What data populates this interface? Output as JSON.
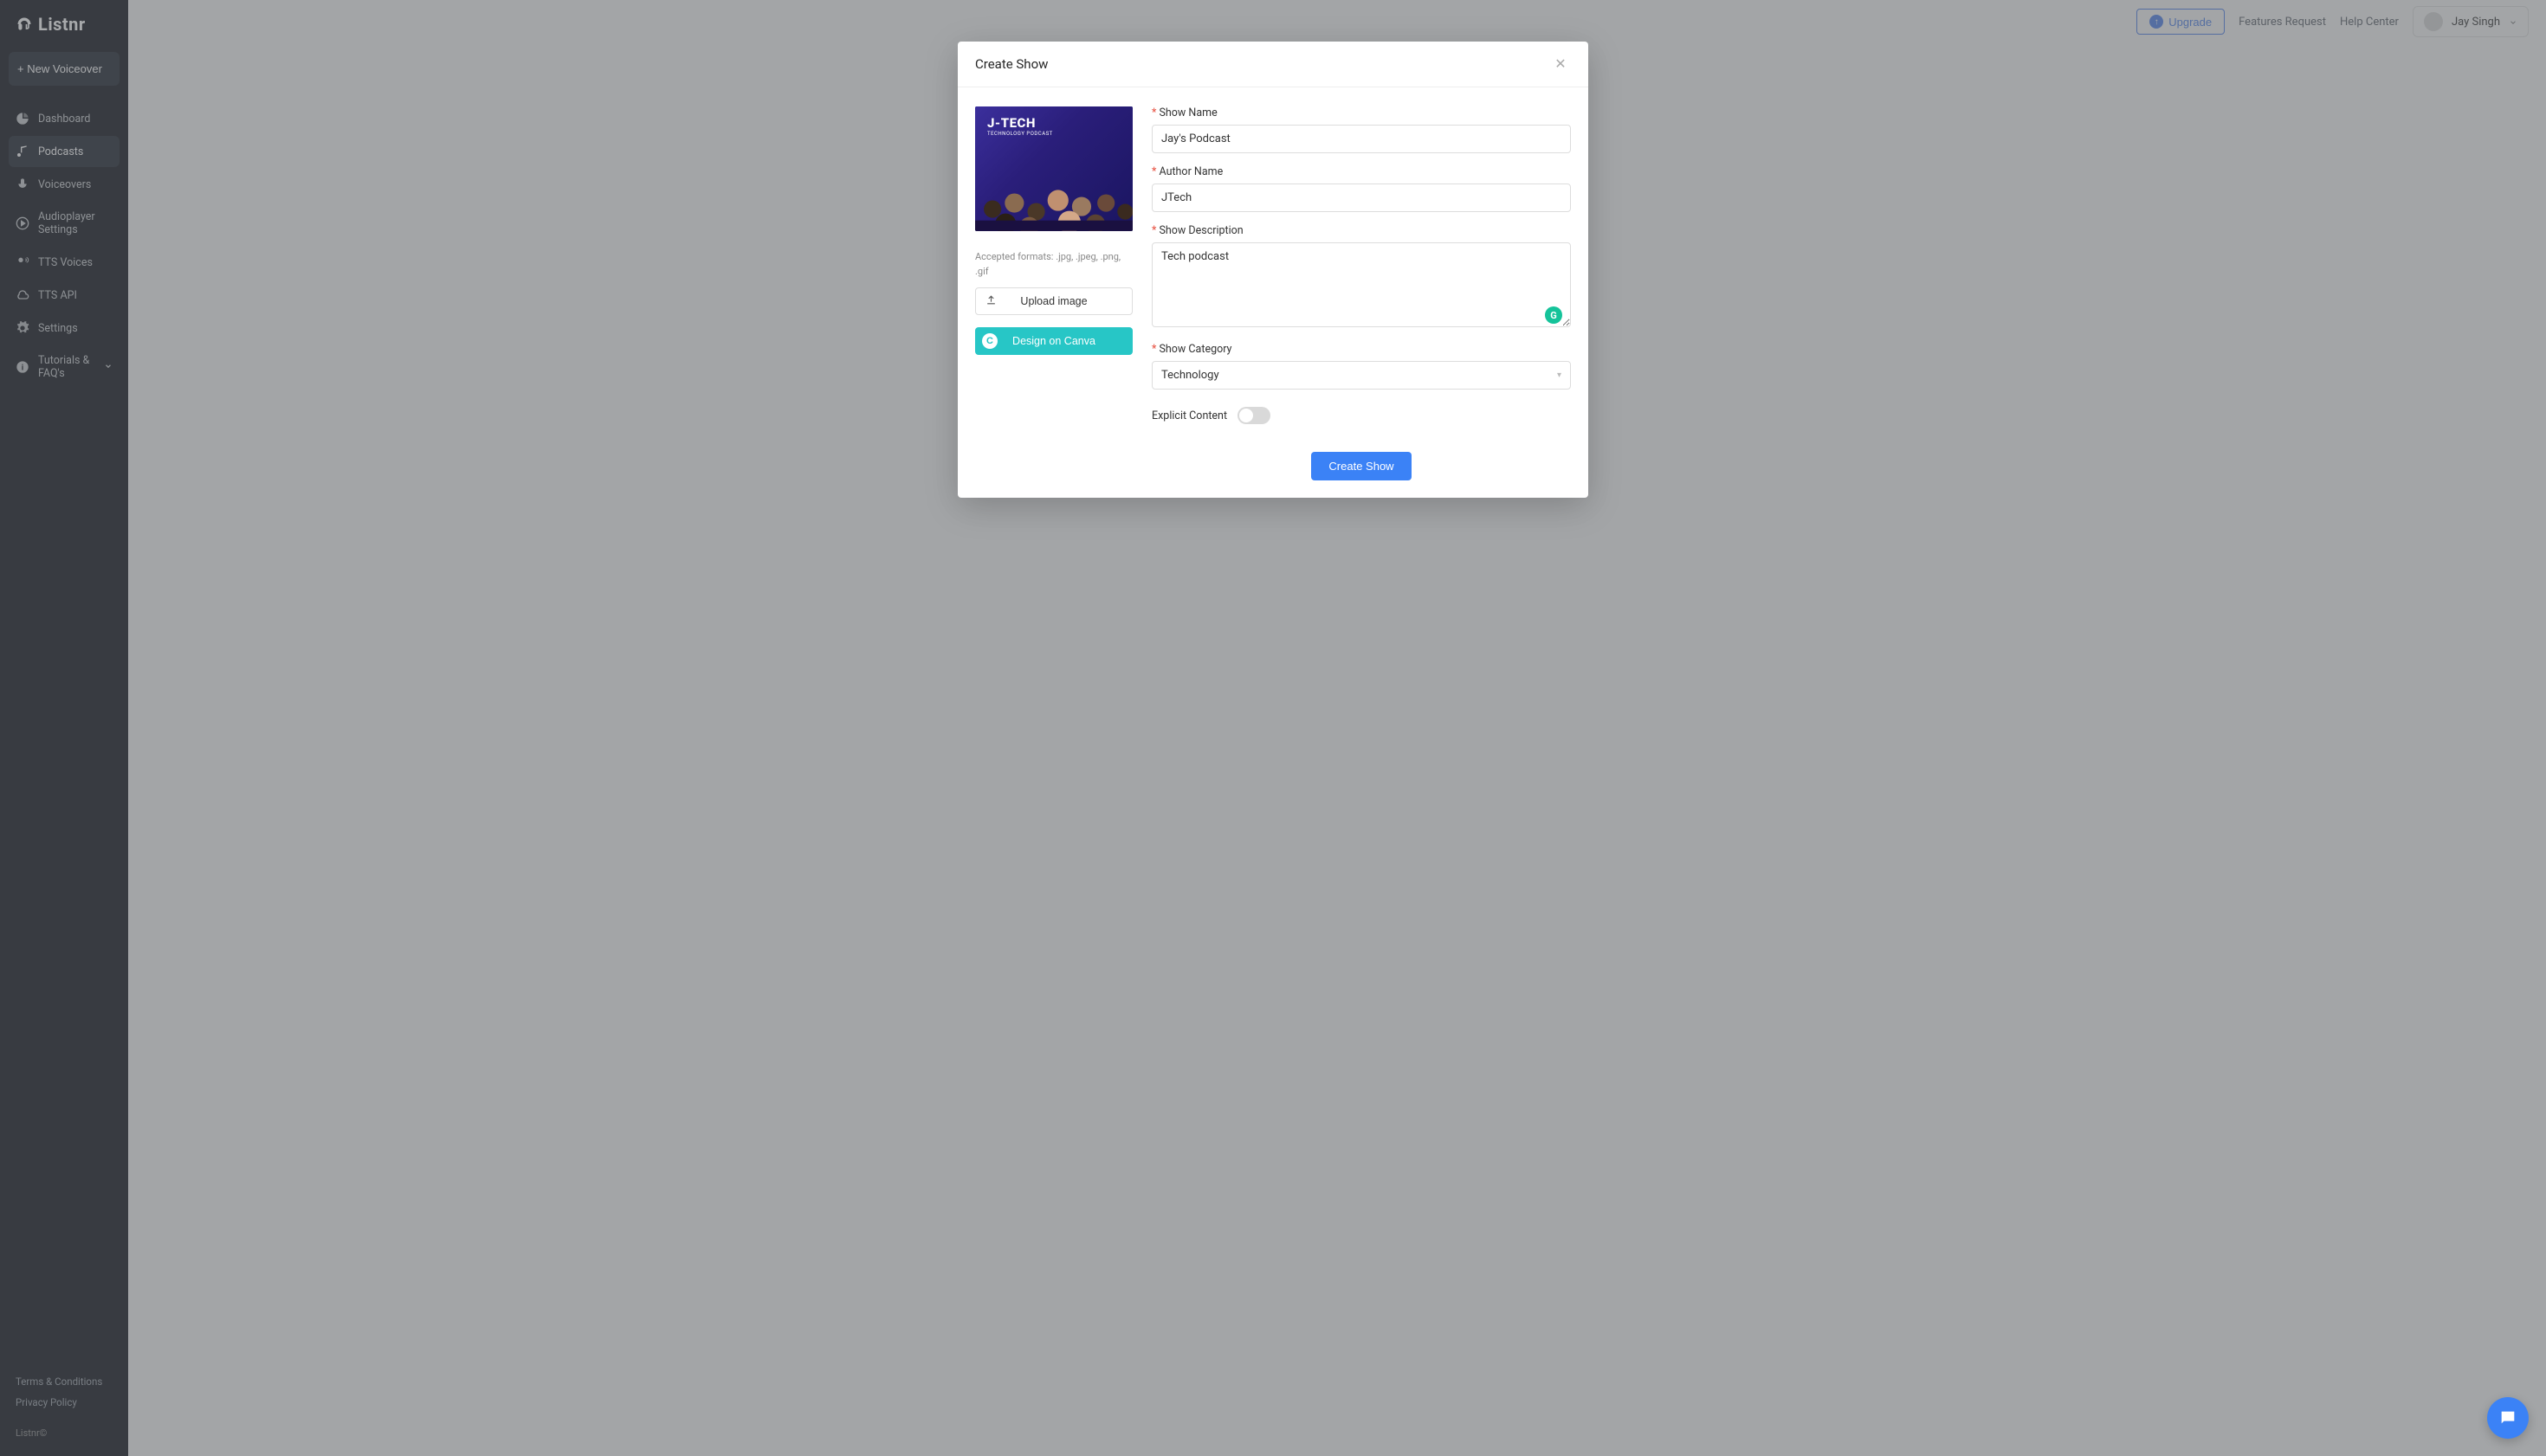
{
  "brand": {
    "name": "Listnr"
  },
  "sidebar": {
    "new_voiceover": "+ New Voiceover",
    "items": [
      {
        "label": "Dashboard",
        "icon": "pie-chart-icon",
        "active": false
      },
      {
        "label": "Podcasts",
        "icon": "music-note-icon",
        "active": true
      },
      {
        "label": "Voiceovers",
        "icon": "mic-icon",
        "active": false
      },
      {
        "label": "Audioplayer Settings",
        "icon": "play-circle-icon",
        "active": false
      },
      {
        "label": "TTS Voices",
        "icon": "voice-icon",
        "active": false
      },
      {
        "label": "TTS API",
        "icon": "cloud-icon",
        "active": false
      },
      {
        "label": "Settings",
        "icon": "gear-icon",
        "active": false
      },
      {
        "label": "Tutorials & FAQ's",
        "icon": "info-icon",
        "active": false,
        "chevron": true
      }
    ],
    "footer": {
      "terms": "Terms & Conditions",
      "privacy": "Privacy Policy",
      "copyright": "Listnr©"
    }
  },
  "topbar": {
    "upgrade": "Upgrade",
    "features_request": "Features Request",
    "help_center": "Help Center",
    "user": "Jay Singh"
  },
  "modal": {
    "title": "Create Show",
    "preview": {
      "title": "J-TECH",
      "subtitle": "TECHNOLOGY PODCAST"
    },
    "accepted_formats": "Accepted formats: .jpg, .jpeg, .png, .gif",
    "upload_image": "Upload image",
    "design_canva": "Design on Canva",
    "fields": {
      "show_name_label": "Show Name",
      "show_name_value": "Jay's Podcast",
      "author_label": "Author Name",
      "author_value": "JTech",
      "description_label": "Show Description",
      "description_value": "Tech podcast",
      "category_label": "Show Category",
      "category_value": "Technology",
      "explicit_label": "Explicit Content",
      "explicit_value": false
    },
    "submit": "Create Show"
  }
}
